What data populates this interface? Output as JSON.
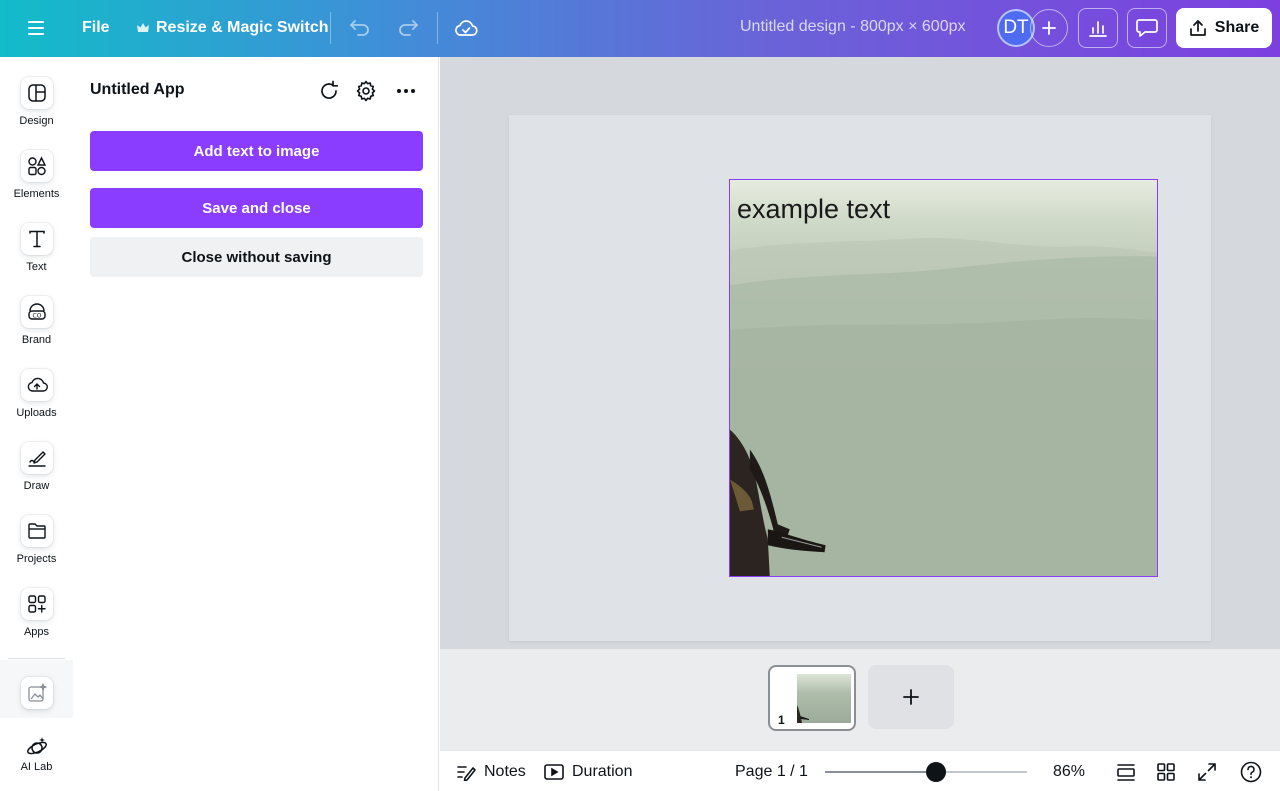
{
  "topbar": {
    "file_label": "File",
    "resize_label": "Resize & Magic Switch",
    "doc_title": "Untitled design - 800px × 600px",
    "avatar_initials": "DT",
    "share_label": "Share"
  },
  "rail": {
    "items": [
      {
        "label": "Design",
        "icon": "layout-icon"
      },
      {
        "label": "Elements",
        "icon": "shapes-icon"
      },
      {
        "label": "Text",
        "icon": "text-icon"
      },
      {
        "label": "Brand",
        "icon": "brand-icon"
      },
      {
        "label": "Uploads",
        "icon": "cloud-upload-icon"
      },
      {
        "label": "Draw",
        "icon": "pen-icon"
      },
      {
        "label": "Projects",
        "icon": "folder-icon"
      },
      {
        "label": "Apps",
        "icon": "apps-icon"
      }
    ],
    "ai_lab_label": "AI Lab"
  },
  "panel": {
    "title": "Untitled App",
    "buttons": {
      "add_text": "Add text to image",
      "save_close": "Save and close",
      "close_no_save": "Close without saving"
    }
  },
  "canvas": {
    "overlay_text": "example text"
  },
  "strip": {
    "page_number": "1"
  },
  "footer": {
    "notes_label": "Notes",
    "duration_label": "Duration",
    "page_indicator": "Page 1 / 1",
    "zoom": "86%",
    "zoom_slider_fraction": 0.55
  },
  "colors": {
    "accent": "#8b3dff",
    "topbar_start": "#12bcc9",
    "topbar_end": "#7d3fe0"
  }
}
